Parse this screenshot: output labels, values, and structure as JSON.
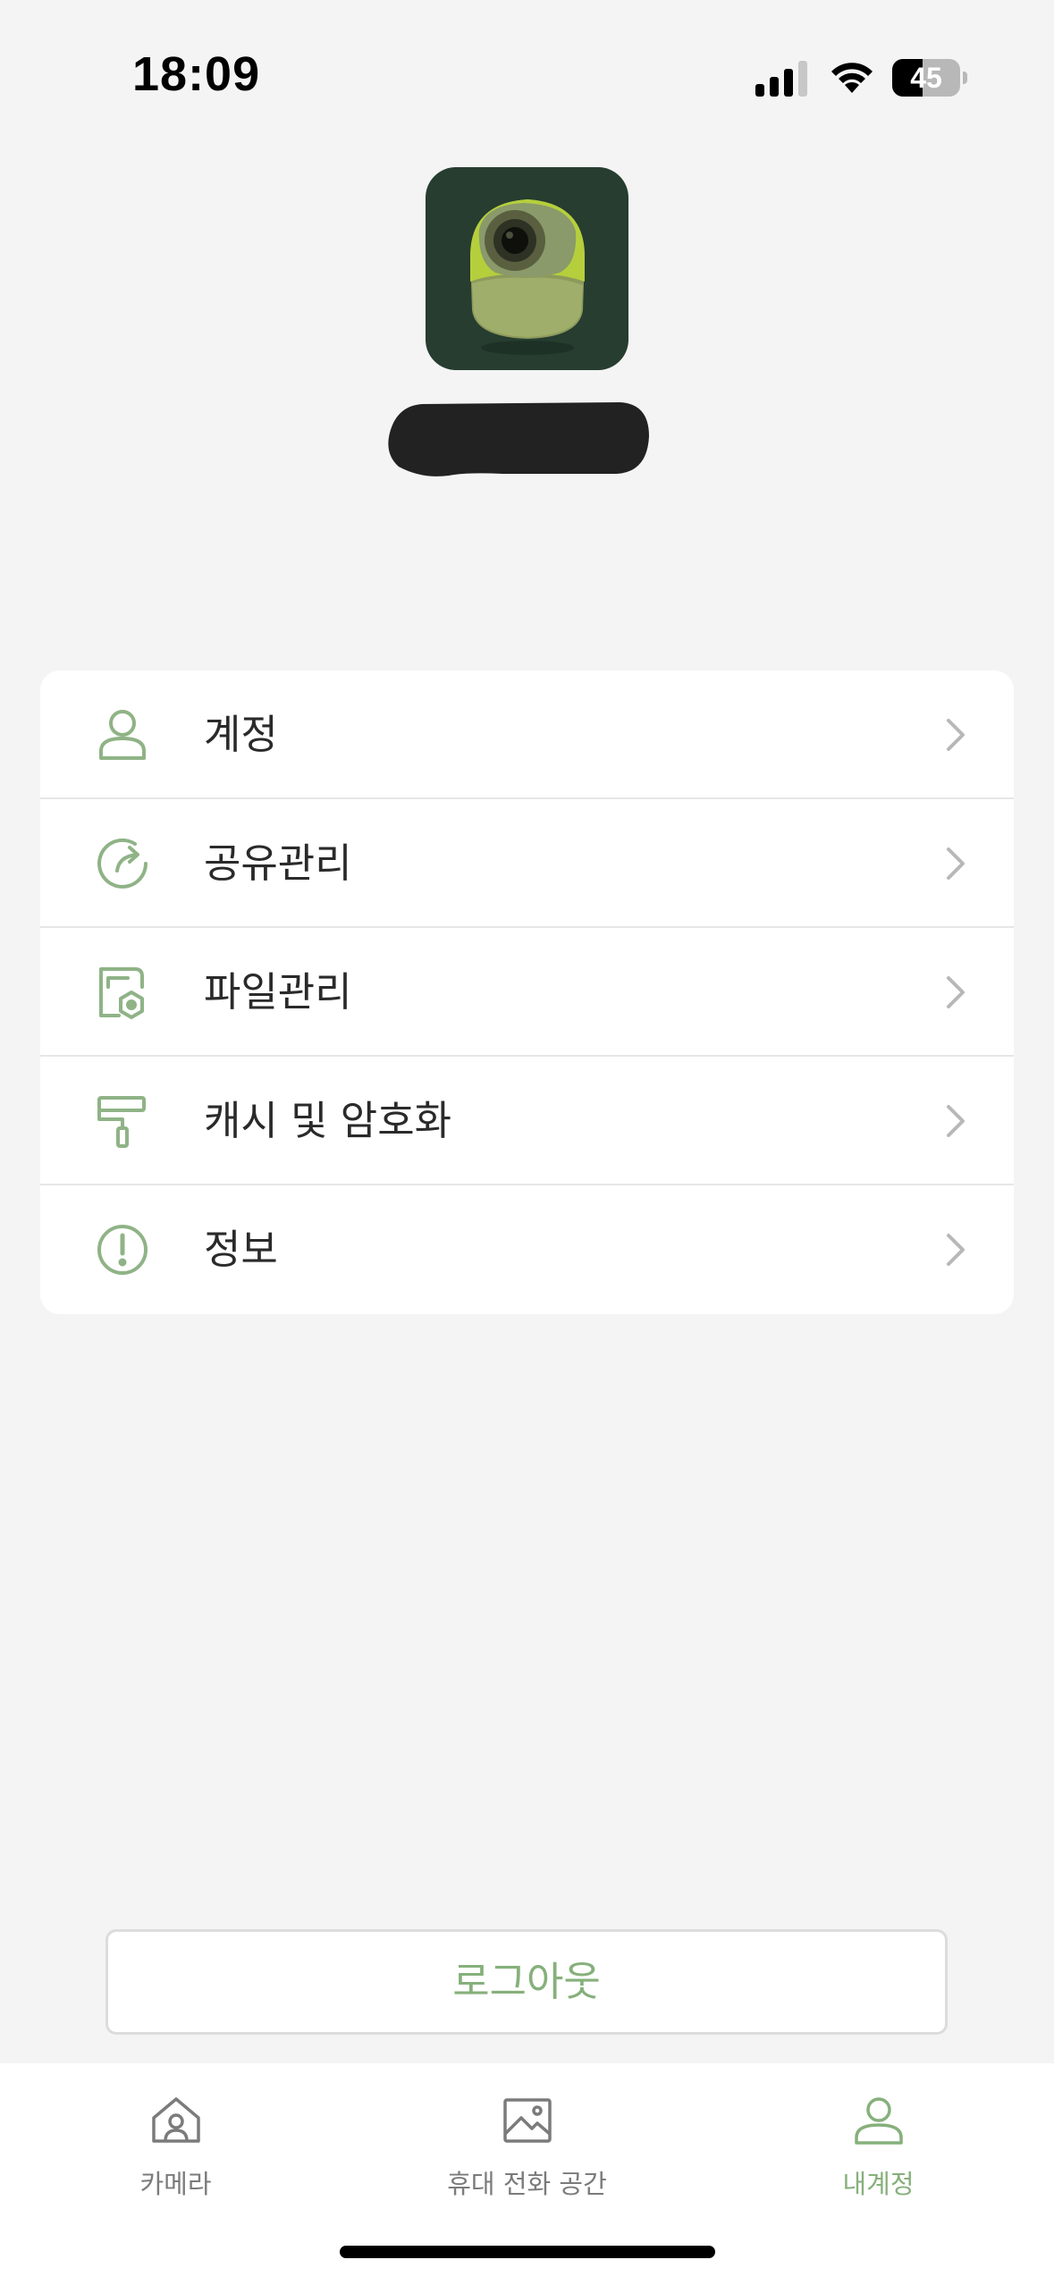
{
  "status_bar": {
    "time": "18:09",
    "battery_level": "45",
    "battery_fraction": 0.45
  },
  "colors": {
    "accent": "#86b07b",
    "icon_green": "#8fb386",
    "background": "#f4f4f4",
    "logo_bg": "#263d30",
    "logo_lime": "#b5cf3c"
  },
  "profile": {
    "logo_icon": "camera-app-logo",
    "name_redacted": true
  },
  "menu": {
    "items": [
      {
        "label": "계정",
        "icon": "user-icon"
      },
      {
        "label": "공유관리",
        "icon": "share-refresh-icon"
      },
      {
        "label": "파일관리",
        "icon": "file-settings-icon"
      },
      {
        "label": "캐시 및 암호화",
        "icon": "paint-roller-icon"
      },
      {
        "label": "정보",
        "icon": "info-exclamation-icon"
      }
    ]
  },
  "logout": {
    "label": "로그아웃"
  },
  "tabs": [
    {
      "label": "카메라",
      "icon": "home-camera-icon",
      "active": false
    },
    {
      "label": "휴대 전화 공간",
      "icon": "image-icon",
      "active": false
    },
    {
      "label": "내계정",
      "icon": "user-icon",
      "active": true
    }
  ]
}
